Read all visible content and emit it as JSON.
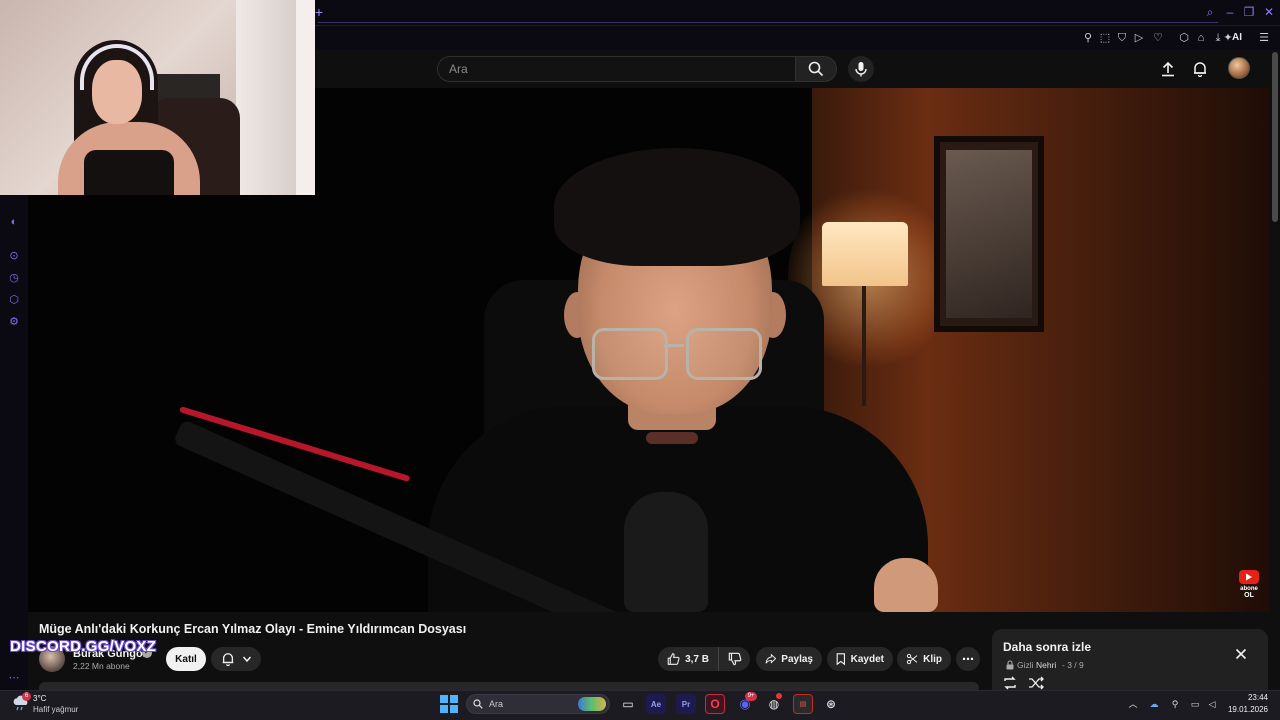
{
  "browser": {
    "new_tab_icon": "plus-icon",
    "ai_label": "AI"
  },
  "youtube": {
    "search": {
      "placeholder": "Ara"
    }
  },
  "video": {
    "title": "Müge Anlı'daki Korkunç Ercan Yılmaz Olayı - Emine Yıldırımcan Dosyası",
    "subscribe_badge_label": "abone OL"
  },
  "overlay": {
    "discord_text": "DISCORD.GG/VOXZ"
  },
  "channel": {
    "name": "Burak Güngör",
    "subscribers": "2,22 Mn abone",
    "join_label": "Katıl"
  },
  "actions": {
    "likes": "3,7 B",
    "share": "Paylaş",
    "save": "Kaydet",
    "clip": "Klip"
  },
  "watch_later": {
    "title": "Daha sonra izle",
    "privacy": "Gizli",
    "owner": "Nehri",
    "position": "- 3 / 9"
  },
  "taskbar": {
    "weather": {
      "temp": "3°C",
      "condition": "Hafif yağmur",
      "badge": "6"
    },
    "search_label": "Ara",
    "apps": [
      {
        "name": "after-effects",
        "label": "Ae",
        "color": "#1f1a4d",
        "fg": "#9999ff"
      },
      {
        "name": "premiere",
        "label": "Pr",
        "color": "#1f1a4d",
        "fg": "#9999ff"
      }
    ],
    "discord_badge": "9+",
    "clock": {
      "time": "23:44",
      "date": "19.01.2026"
    }
  },
  "colors": {
    "accent": "#7d6ef0",
    "youtube_bg": "#0f0f0f",
    "pill_bg": "#272727"
  }
}
